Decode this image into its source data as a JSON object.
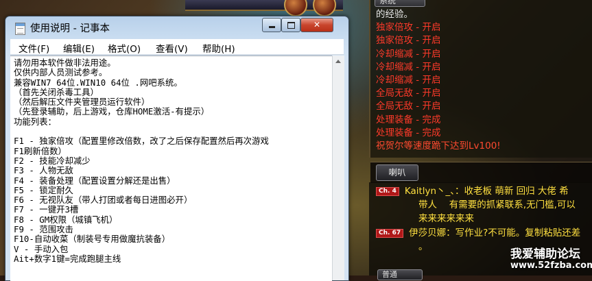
{
  "window": {
    "title": "使用说明 - 记事本",
    "close_glyph": "✕"
  },
  "menu": {
    "items": [
      "文件(F)",
      "编辑(E)",
      "格式(O)",
      "查看(V)",
      "帮助(H)"
    ]
  },
  "document": {
    "lines": [
      "请勿用本软件做非法用途。",
      "仅供内部人员测试参考。",
      "兼容WIN7 64位.WIN10 64位 .网吧系统。",
      "（首先关闭杀毒工具）",
      "（然后解压文件夹管理员运行软件）",
      "（先登录辅助，后上游戏，仓库HOME激活-有提示）",
      "功能列表：",
      "",
      "F1 - 独家倍攻（配置里修改倍数，改了之后保存配置然后再次游戏",
      "F1刷新倍数）",
      "F2 - 技能冷却减少",
      "F3 - 人物无敌",
      "F4 - 装备处理（配置设置分解还是出售）",
      "F5 - 锁定耐久",
      "F6 - 无视队友（带人打团或者每日进图必开）",
      "F7 - 一键开3槽",
      "F8 - GM权限（城镇飞机）",
      "F9 - 范围攻击",
      "F10-自动收菜（制装号专用做魔抗装备）",
      "V - 手动入包",
      "Ait+数字1键=完成跑腿主线"
    ]
  },
  "game": {
    "system_tab": "系统",
    "system_lines": [
      {
        "text": "的经验。",
        "color": "#e8e8e8"
      },
      {
        "text": "独家倍攻 - 开启",
        "color": "#ff3a2a"
      },
      {
        "text": "独家倍攻 - 开启",
        "color": "#ff3a2a"
      },
      {
        "text": "冷却缩减 - 开启",
        "color": "#ff3a2a"
      },
      {
        "text": "冷却缩减 - 开启",
        "color": "#ff3a2a"
      },
      {
        "text": "冷却缩减 - 开启",
        "color": "#ff3a2a"
      },
      {
        "text": "全局无敌 - 开启",
        "color": "#ff3a2a"
      },
      {
        "text": "全局无敌 - 开启",
        "color": "#ff3a2a"
      },
      {
        "text": "处理装备 - 完成",
        "color": "#ff3a2a"
      },
      {
        "text": "处理装备 - 完成",
        "color": "#ff3a2a"
      },
      {
        "text": "祝贺尔等速度跪下达到Lv100!",
        "color": "#ff4a30"
      }
    ],
    "shout_tab": "喇叭",
    "shout_messages": [
      {
        "channel": "Ch. 4",
        "name": "Kaitlyn丶_、：",
        "lines": [
          "收老板 萌新 回归 大佬 希",
          "带人　 有需要的抓紧联系,无门槛,可以",
          "来来来来来来"
        ]
      },
      {
        "channel": "Ch. 67",
        "name": "伊莎贝娜：",
        "lines": [
          "写作业?不可能。复制粘贴还差",
          "。"
        ]
      }
    ],
    "normal_tab": "普通",
    "watermark_title": "我爱辅助论坛",
    "watermark_url": "www.52fzba.com"
  }
}
